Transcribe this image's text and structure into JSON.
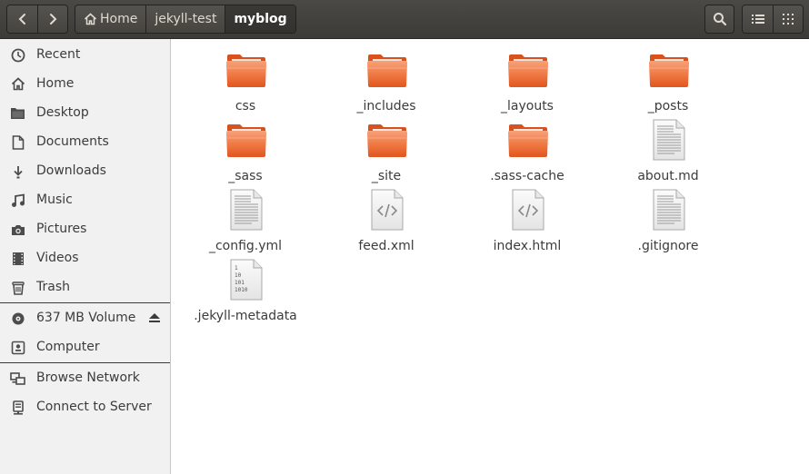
{
  "header": {
    "back_icon": "chevron-left-icon",
    "forward_icon": "chevron-right-icon",
    "breadcrumbs": [
      {
        "label": "Home",
        "icon": "home-icon"
      },
      {
        "label": "jekyll-test"
      },
      {
        "label": "myblog",
        "active": true
      }
    ],
    "search_icon": "search-icon",
    "list_view_icon": "list-view-icon",
    "grid_view_icon": "grid-view-icon"
  },
  "sidebar": {
    "items": [
      {
        "label": "Recent",
        "icon": "clock-icon"
      },
      {
        "label": "Home",
        "icon": "home-icon"
      },
      {
        "label": "Desktop",
        "icon": "desktop-folder-icon"
      },
      {
        "label": "Documents",
        "icon": "document-icon"
      },
      {
        "label": "Downloads",
        "icon": "download-icon"
      },
      {
        "label": "Music",
        "icon": "music-icon"
      },
      {
        "label": "Pictures",
        "icon": "camera-icon"
      },
      {
        "label": "Videos",
        "icon": "film-icon"
      },
      {
        "label": "Trash",
        "icon": "trash-icon"
      }
    ],
    "devices": [
      {
        "label": "637 MB Volume",
        "icon": "disc-icon",
        "eject_icon": "eject-icon"
      },
      {
        "label": "Computer",
        "icon": "computer-icon"
      }
    ],
    "network": [
      {
        "label": "Browse Network",
        "icon": "network-icon"
      },
      {
        "label": "Connect to Server",
        "icon": "server-icon"
      }
    ]
  },
  "files": [
    {
      "name": "css",
      "type": "folder"
    },
    {
      "name": "_includes",
      "type": "folder"
    },
    {
      "name": "_layouts",
      "type": "folder"
    },
    {
      "name": "_posts",
      "type": "folder"
    },
    {
      "name": "_sass",
      "type": "folder"
    },
    {
      "name": "_site",
      "type": "folder"
    },
    {
      "name": ".sass-cache",
      "type": "folder"
    },
    {
      "name": "about.md",
      "type": "text"
    },
    {
      "name": "_config.yml",
      "type": "text"
    },
    {
      "name": "feed.xml",
      "type": "code"
    },
    {
      "name": "index.html",
      "type": "code"
    },
    {
      "name": ".gitignore",
      "type": "text"
    },
    {
      "name": ".jekyll-metadata",
      "type": "binary",
      "binary_lines": [
        "1",
        "10",
        "101",
        "1010"
      ]
    }
  ],
  "colors": {
    "folder_top": "#f6956a",
    "folder_bottom": "#e1561e",
    "header_bg": "#3c3b37",
    "sidebar_bg": "#f1f1f1"
  }
}
